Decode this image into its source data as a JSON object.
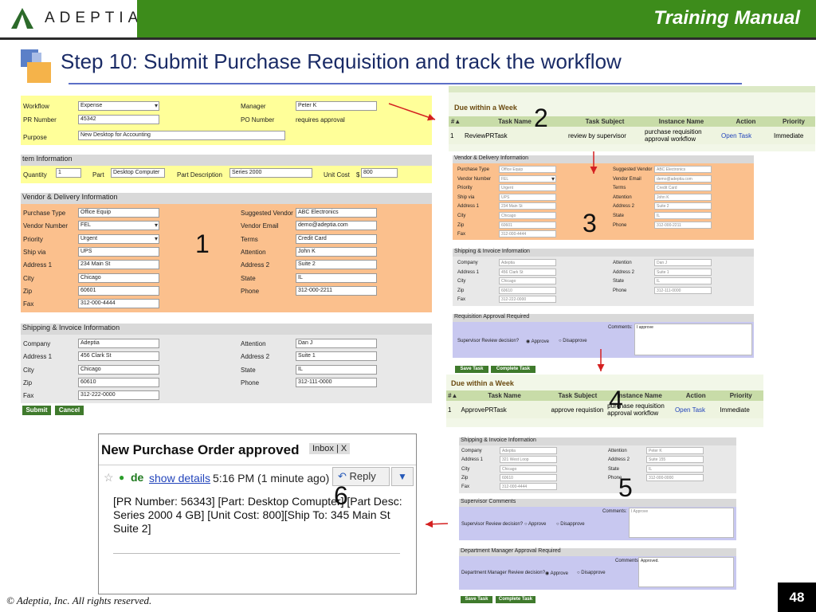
{
  "header": {
    "logo": "ADEPTIA",
    "manual": "Training Manual",
    "title": "Step 10: Submit Purchase Requisition and track the workflow"
  },
  "footer": {
    "copyright": "© Adeptia, Inc.  All rights reserved.",
    "page": "48"
  },
  "steps": [
    "1",
    "2",
    "3",
    "4",
    "5",
    "6"
  ],
  "form": {
    "workflow_label": "Workflow",
    "workflow": "Expense",
    "pr_label": "PR Number",
    "pr": "45342",
    "purpose_label": "Purpose",
    "purpose": "New Desktop for Accounting",
    "manager_label": "Manager",
    "manager": "Peter K",
    "po_label": "PO Number",
    "po": "requires approval",
    "item_sec": "tem Information",
    "qty_label": "Quantity",
    "qty": "1",
    "part_label": "Part",
    "part": "Desktop Computer",
    "desc_label": "Part Description",
    "desc": "Series 2000",
    "cost_label": "Unit Cost",
    "cost_sym": "$",
    "cost": "800",
    "vendor_sec": "Vendor & Delivery Information",
    "v_left": [
      [
        "Purchase Type",
        "Office Equip"
      ],
      [
        "Vendor Number",
        "FEL"
      ],
      [
        "Priority",
        "Urgent"
      ],
      [
        "Ship via",
        "UPS"
      ],
      [
        "Address 1",
        "234 Main St"
      ],
      [
        "City",
        "Chicago"
      ],
      [
        "Zip",
        "60601"
      ],
      [
        "Fax",
        "312-000-4444"
      ]
    ],
    "v_right": [
      [
        "Suggested Vendor",
        "ABC Electronics"
      ],
      [
        "Vendor Email",
        "demo@adeptia.com"
      ],
      [
        "Terms",
        "Credit Card"
      ],
      [
        "Attention",
        "John K"
      ],
      [
        "Address 2",
        "Suite 2"
      ],
      [
        "State",
        "IL"
      ],
      [
        "Phone",
        "312-000-2211"
      ]
    ],
    "ship_sec": "Shipping & Invoice Information",
    "s_left": [
      [
        "Company",
        "Adeptia"
      ],
      [
        "Address 1",
        "456 Clark St"
      ],
      [
        "City",
        "Chicago"
      ],
      [
        "Zip",
        "60610"
      ],
      [
        "Fax",
        "312-222-0000"
      ]
    ],
    "s_right": [
      [
        "Attention",
        "Dan J"
      ],
      [
        "Address 2",
        "Suite 1"
      ],
      [
        "State",
        "IL"
      ],
      [
        "Phone",
        "312-111-0000"
      ]
    ],
    "submit": "Submit",
    "cancel": "Cancel"
  },
  "task1": {
    "heading": "Due within a Week",
    "cols": [
      "#▲",
      "Task Name",
      "Task Subject",
      "Instance Name",
      "Action",
      "Priority"
    ],
    "row": [
      "1",
      "ReviewPRTask",
      "review by supervisor",
      "purchase requisition approval workflow",
      "Open Task",
      "Immediate"
    ]
  },
  "task2": {
    "heading": "Due within a Week",
    "cols": [
      "#▲",
      "Task Name",
      "Task Subject",
      "Instance Name",
      "Action",
      "Priority"
    ],
    "row": [
      "1",
      "ApprovePRTask",
      "approve requistion",
      "purchase requisition approval workflow",
      "Open Task",
      "Immediate"
    ]
  },
  "review": {
    "vendor_sec": "Vendor & Delivery Information",
    "left": [
      [
        "Purchase Type",
        "Office Equip"
      ],
      [
        "Vendor Number",
        "FEL"
      ],
      [
        "Priority",
        "Urgent"
      ],
      [
        "Ship via",
        "UPS"
      ],
      [
        "Address 1",
        "234 Main St"
      ],
      [
        "City",
        "Chicago"
      ],
      [
        "Zip",
        "60601"
      ],
      [
        "Fax",
        "312-000-4444"
      ]
    ],
    "right": [
      [
        "Suggested Vendor",
        "ABC Electronics"
      ],
      [
        "Vendor Email",
        "demo@adeptia.com"
      ],
      [
        "Terms",
        "Credit Card"
      ],
      [
        "Attention",
        "John K"
      ],
      [
        "Address 2",
        "Suite 2"
      ],
      [
        "State",
        "IL"
      ],
      [
        "Phone",
        "312-000-2211"
      ]
    ],
    "ship_sec": "Shipping & Invoice Information",
    "sleft": [
      [
        "Company",
        "Adeptia"
      ],
      [
        "Address 1",
        "456 Clark St"
      ],
      [
        "City",
        "Chicago"
      ],
      [
        "Zip",
        "60610"
      ],
      [
        "Fax",
        "312-222-0000"
      ]
    ],
    "sright": [
      [
        "Attention",
        "Dan J"
      ],
      [
        "Address 2",
        "Suite 1"
      ],
      [
        "State",
        "IL"
      ],
      [
        "Phone",
        "312-111-0000"
      ]
    ],
    "appr_sec": "Requisition Approval Required",
    "comments": "Comments:",
    "comment_val": "I approve",
    "decision": "Supervisor Review decision?",
    "approve": "Approve",
    "disapprove": "Disapprove",
    "save": "Save Task",
    "complete": "Complete Task"
  },
  "approve": {
    "ship_sec": "Shipping & Invoice Information",
    "left": [
      [
        "Company",
        "Adeptia"
      ],
      [
        "Address 1",
        "321 West Loop"
      ],
      [
        "City",
        "Chicago"
      ],
      [
        "Zip",
        "60610"
      ],
      [
        "Fax",
        "312-000-4444"
      ]
    ],
    "right": [
      [
        "Attention",
        "Peter K"
      ],
      [
        "Address 2",
        "Suite 155"
      ],
      [
        "State",
        "IL"
      ],
      [
        "Phone",
        "312-000-0000"
      ]
    ],
    "sup_sec": "Supervisor Comments",
    "comments": "Comments:",
    "sup_val": "I Approve",
    "sup_decision": "Supervisor Review decision?",
    "approve": "Approve",
    "disapprove": "Disapprove",
    "dm_sec": "Department Manager Approval Required",
    "dm_val": "Approved.",
    "dm_decision": "Department Manager Review decision?",
    "save": "Save Task",
    "complete": "Complete Task"
  },
  "email": {
    "subject": "New Purchase Order approved",
    "inbox": "Inbox",
    "x": "X",
    "star": "☆",
    "dot": "●",
    "from": "de",
    "show": "show details",
    "time": "5:16 PM (1 minute ago)",
    "reply": "Reply",
    "body": "[PR Number: 56343] [Part: Desktop Comupter] [Part Desc: Series 2000 4 GB] [Unit Cost: 800][Ship To: 345 Main St Suite 2]"
  },
  "colors": {
    "green": "#3d8c1b",
    "form_yellow": "#ffff99",
    "form_orange": "#fbc08d",
    "form_gray": "#e8e8e8",
    "approval_purple": "#c8c8f0",
    "arrow": "#d42020"
  }
}
